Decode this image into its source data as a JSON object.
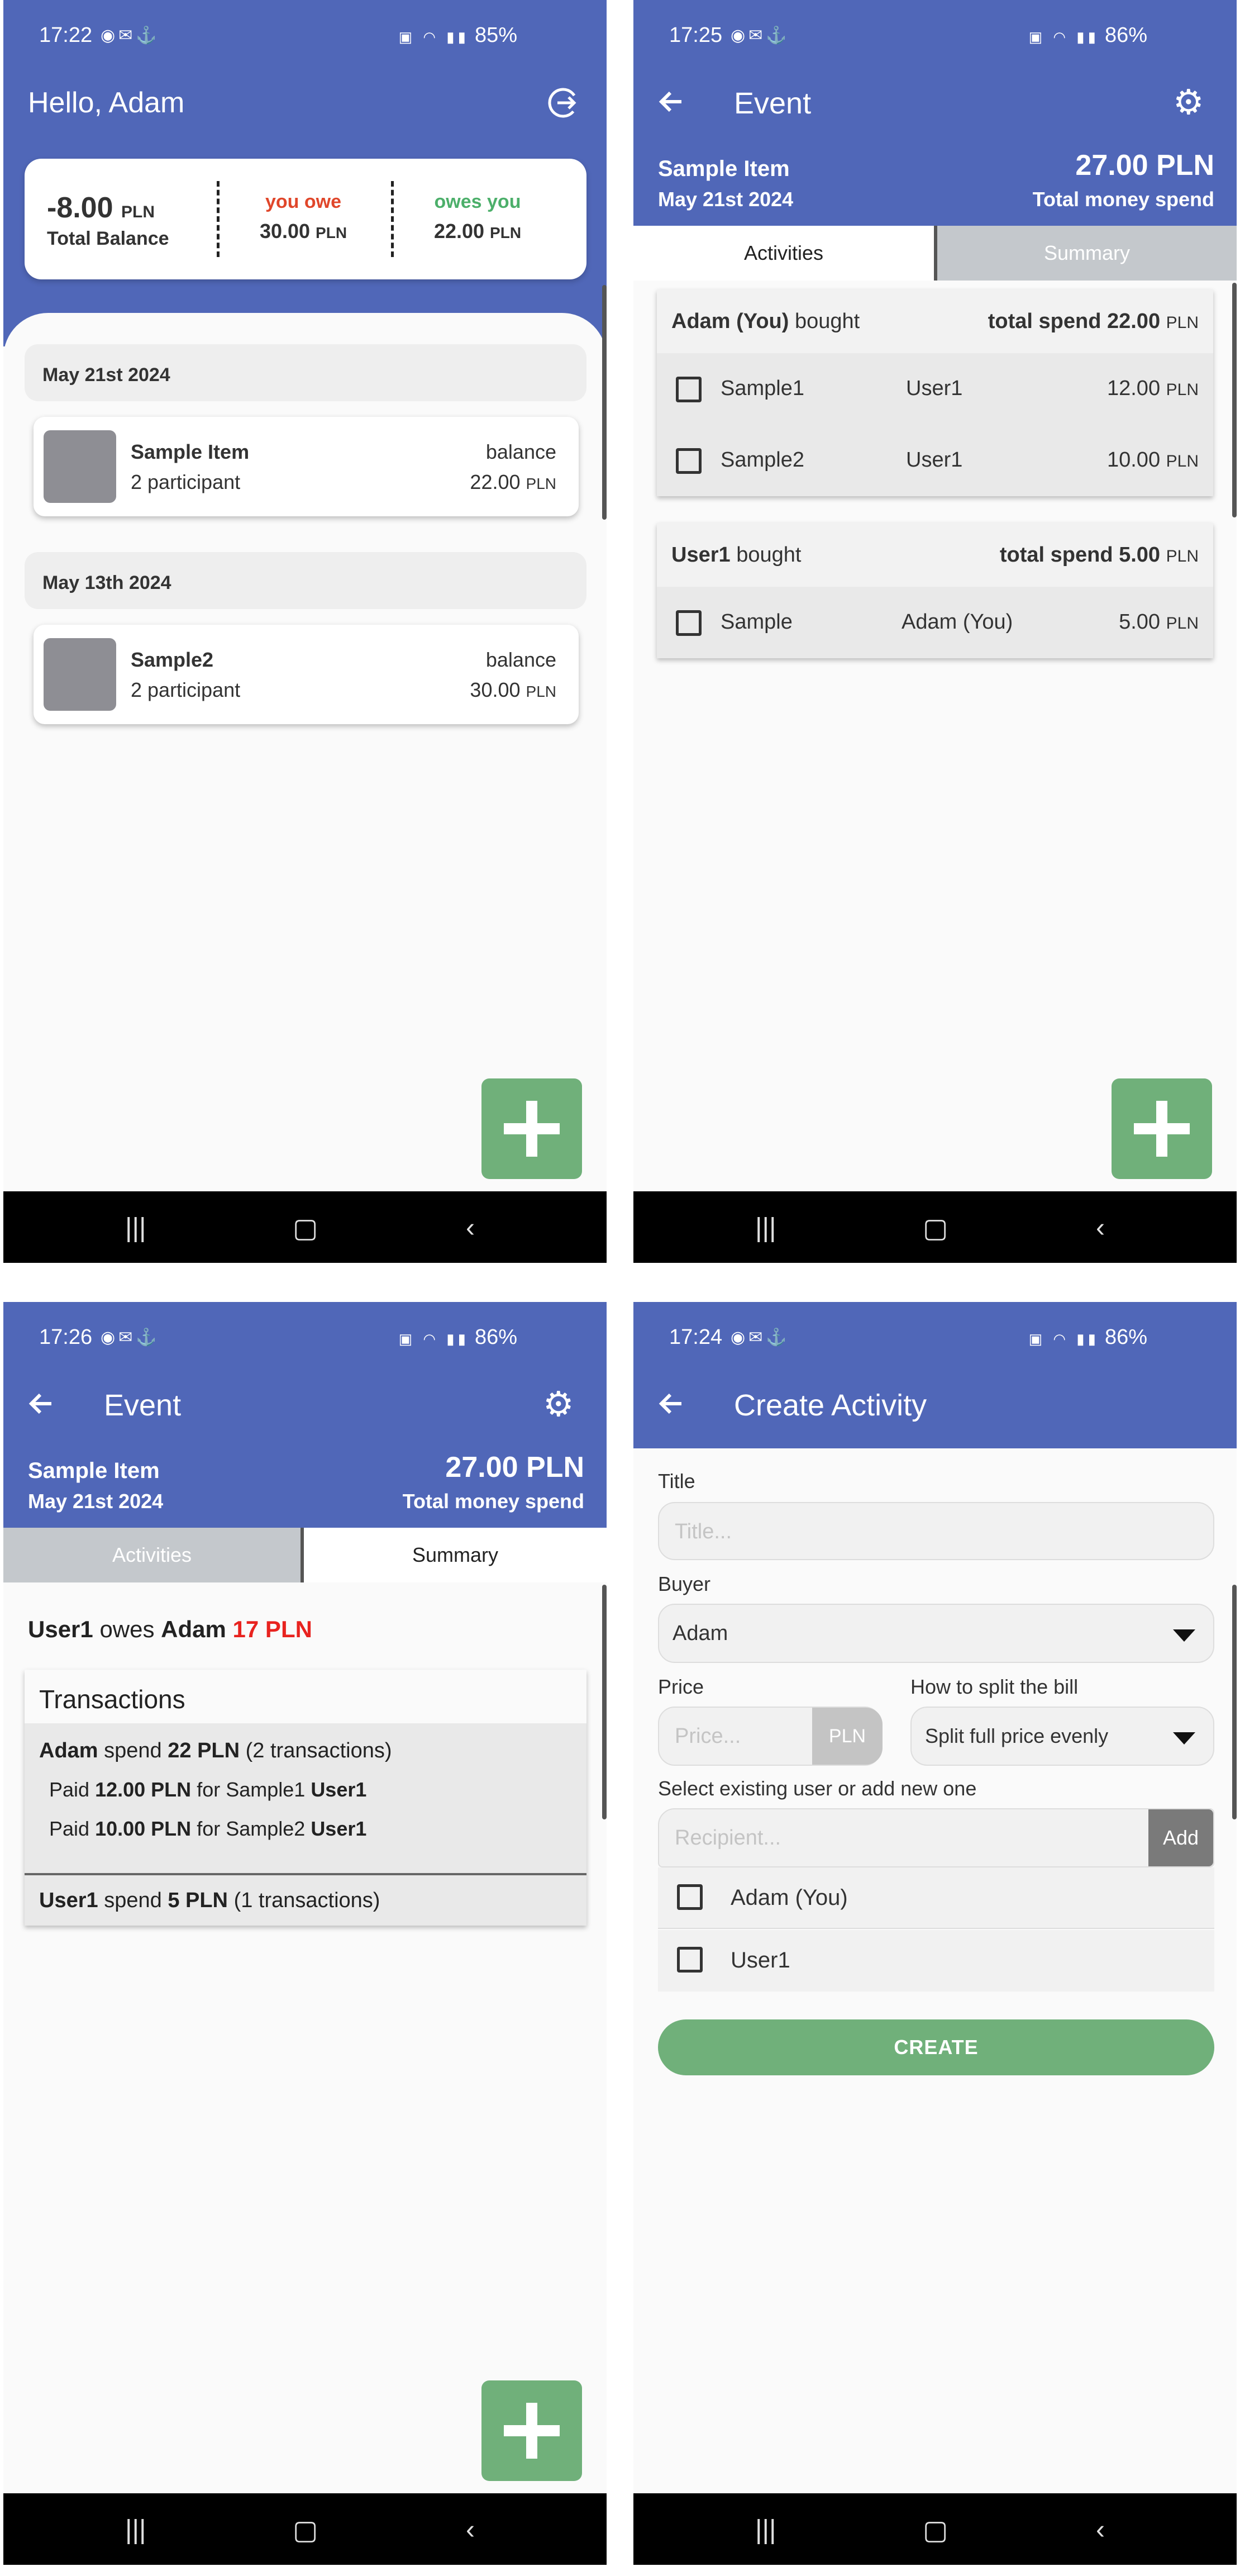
{
  "colors": {
    "header": "#5067b8",
    "fab": "#70b07a",
    "red": "#e8231f",
    "green": "#4caf6a"
  },
  "screens": {
    "home": {
      "status": {
        "time": "17:22",
        "battery": "85%"
      },
      "title": "Hello, Adam",
      "logout_icon": "logout-icon",
      "balance": {
        "total": "-8.00",
        "total_cur": "PLN",
        "total_label": "Total Balance",
        "owe_label": "you owe",
        "owe_value": "30.00",
        "owe_cur": "PLN",
        "owes_label": "owes you",
        "owes_value": "22.00",
        "owes_cur": "PLN"
      },
      "groups": [
        {
          "date": "May 21st 2024",
          "event": {
            "name": "Sample Item",
            "participants": "2 participant",
            "balance_label": "balance",
            "balance": "22.00",
            "cur": "PLN"
          }
        },
        {
          "date": "May 13th 2024",
          "event": {
            "name": "Sample2",
            "participants": "2 participant",
            "balance_label": "balance",
            "balance": "30.00",
            "cur": "PLN"
          }
        }
      ]
    },
    "event_activities": {
      "status": {
        "time": "17:25",
        "battery": "86%"
      },
      "title": "Event",
      "event_name": "Sample Item",
      "event_date": "May 21st 2024",
      "total": "27.00 PLN",
      "total_label": "Total money spend",
      "tabs": [
        "Activities",
        "Summary"
      ],
      "activities": [
        {
          "buyer": "Adam (You)",
          "bought": "bought",
          "total_label": "total spend",
          "total": "22.00",
          "cur": "PLN",
          "items": [
            {
              "name": "Sample1",
              "user": "User1",
              "price": "12.00",
              "cur": "PLN"
            },
            {
              "name": "Sample2",
              "user": "User1",
              "price": "10.00",
              "cur": "PLN"
            }
          ]
        },
        {
          "buyer": "User1",
          "bought": "bought",
          "total_label": "total spend",
          "total": "5.00",
          "cur": "PLN",
          "items": [
            {
              "name": "Sample",
              "user": "Adam (You)",
              "price": "5.00",
              "cur": "PLN"
            }
          ]
        }
      ]
    },
    "event_summary": {
      "status": {
        "time": "17:26",
        "battery": "86%"
      },
      "title": "Event",
      "event_name": "Sample Item",
      "event_date": "May 21st 2024",
      "total": "27.00 PLN",
      "total_label": "Total money spend",
      "tabs": [
        "Activities",
        "Summary"
      ],
      "owe": {
        "from": "User1",
        "verb": "owes",
        "to": "Adam",
        "amount": "17 PLN"
      },
      "transactions_title": "Transactions",
      "spenders": [
        {
          "name": "Adam",
          "spend": "spend",
          "amount": "22 PLN",
          "count": "(2 transactions)",
          "lines": [
            {
              "paid": "Paid",
              "amount": "12.00 PLN",
              "for": "for Sample1",
              "user": "User1"
            },
            {
              "paid": "Paid",
              "amount": "10.00 PLN",
              "for": "for Sample2",
              "user": "User1"
            }
          ]
        },
        {
          "name": "User1",
          "spend": "spend",
          "amount": "5 PLN",
          "count": "(1 transactions)"
        }
      ]
    },
    "create_activity": {
      "status": {
        "time": "17:24",
        "battery": "86%"
      },
      "title": "Create Activity",
      "title_label": "Title",
      "title_placeholder": "Title...",
      "buyer_label": "Buyer",
      "buyer_value": "Adam",
      "price_label": "Price",
      "price_placeholder": "Price...",
      "currency": "PLN",
      "split_label": "How to split the bill",
      "split_value": "Split full price evenly",
      "recipient_label": "Select existing user or add new one",
      "recipient_placeholder": "Recipient...",
      "add_label": "Add",
      "users": [
        "Adam (You)",
        "User1"
      ],
      "create_label": "CREATE"
    }
  }
}
